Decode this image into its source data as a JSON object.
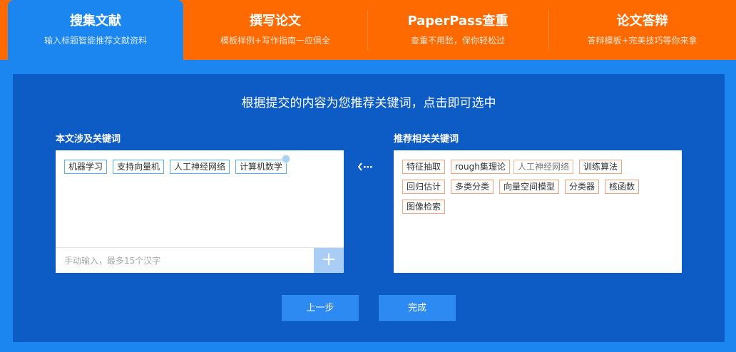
{
  "tabs": [
    {
      "title": "搜集文献",
      "subtitle": "输入标题智能推荐文献资料"
    },
    {
      "title": "撰写论文",
      "subtitle": "模板样例+写作指南一应俱全"
    },
    {
      "title": "PaperPass查重",
      "subtitle": "查重不用愁，保你轻松过"
    },
    {
      "title": "论文答辩",
      "subtitle": "答辩模板+完美技巧等你来拿"
    }
  ],
  "active_tab": "搜集文献",
  "main": {
    "headline": "根据提交的内容为您推荐关键词，点击即可选中",
    "left_label": "本文涉及关键词",
    "right_label": "推荐相关关键词",
    "selected_keywords": [
      "机器学习",
      "支持向量机",
      "人工神经网络",
      "计算机数学"
    ],
    "recommended_keywords": [
      "特征抽取",
      "rough集理论",
      "人工神经网络",
      "训练算法",
      "回归估计",
      "多类分类",
      "向量空间模型",
      "分类器",
      "核函数",
      "图像检索"
    ],
    "input_placeholder": "手动输入，最多15个汉字",
    "add_symbol": "+",
    "prev_label": "上一步",
    "done_label": "完成"
  },
  "icons": {
    "add": "plus-icon",
    "move": "arrow-left-icon",
    "remove": "remove-dot-icon"
  },
  "colors": {
    "tab_bar": "#ff6a00",
    "active_tab": "#1c86f0",
    "panel": "#0d5cc6",
    "button": "#2e8af3"
  }
}
